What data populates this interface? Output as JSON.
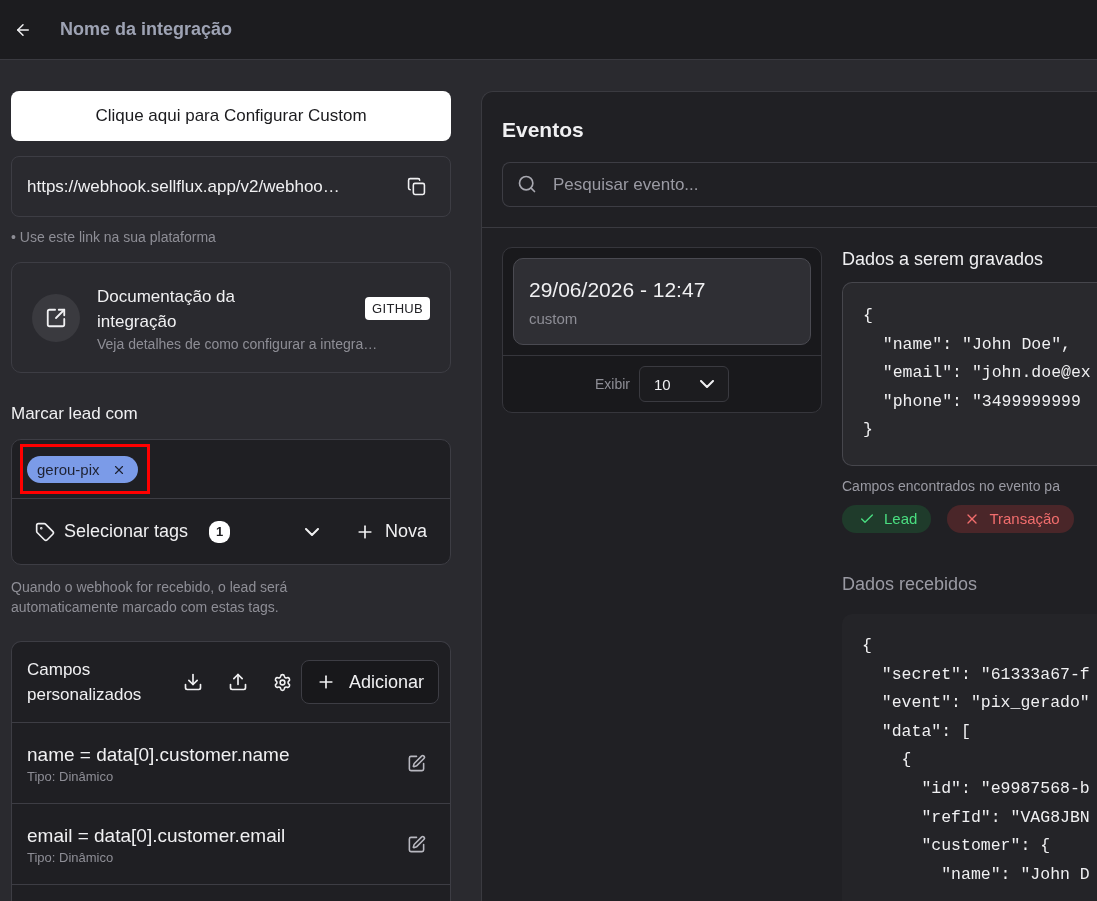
{
  "header": {
    "title": "Nome da integração"
  },
  "sidebar": {
    "configure_button": "Clique aqui para Configurar Custom",
    "webhook_url": "https://webhook.sellflux.app/v2/webhoo…",
    "url_hint": "• Use este link na sua plataforma",
    "documentation": {
      "title": "Documentação da integração",
      "description": "Veja detalhes de como configurar a integra…",
      "badge": "GITHUB"
    },
    "tag_section": {
      "label": "Marcar lead com",
      "tags": [
        {
          "label": "gerou-pix",
          "highlighted": true
        }
      ],
      "select_label": "Selecionar tags",
      "count": "1",
      "new_button": "Nova",
      "help": "Quando o webhook for recebido, o lead será automaticamente marcado com estas tags."
    },
    "custom_fields": {
      "title": "Campos personalizados",
      "add_button": "Adicionar",
      "items": [
        {
          "expression": "name = data[0].customer.name",
          "type": "Tipo: Dinâmico"
        },
        {
          "expression": "email = data[0].customer.email",
          "type": "Tipo: Dinâmico"
        }
      ]
    }
  },
  "events": {
    "title": "Eventos",
    "search": {
      "placeholder": "Pesquisar evento..."
    },
    "items": [
      {
        "date": "29/06/2026 - 12:47",
        "source": "custom",
        "selected": true
      }
    ],
    "page_size": {
      "label": "Exibir",
      "value": "10"
    }
  },
  "details": {
    "saved_title": "Dados a serem gravados",
    "saved_code": [
      "{",
      "  \"name\": \"John Doe\",",
      "  \"email\": \"john.doe@ex",
      "  \"phone\": \"3499999999",
      "}"
    ],
    "found_caption": "Campos encontrados no evento pa",
    "found_fields": [
      {
        "label": "Lead",
        "found": true
      },
      {
        "label": "Transação",
        "found": false
      }
    ],
    "received_title": "Dados recebidos",
    "received_code": [
      "{",
      "  \"secret\": \"61333a67-f",
      "  \"event\": \"pix_gerado\"",
      "  \"data\": [",
      "    {",
      "      \"id\": \"e9987568-b",
      "      \"refId\": \"VAG8JBN",
      "      \"customer\": {",
      "        \"name\": \"John D"
    ]
  }
}
